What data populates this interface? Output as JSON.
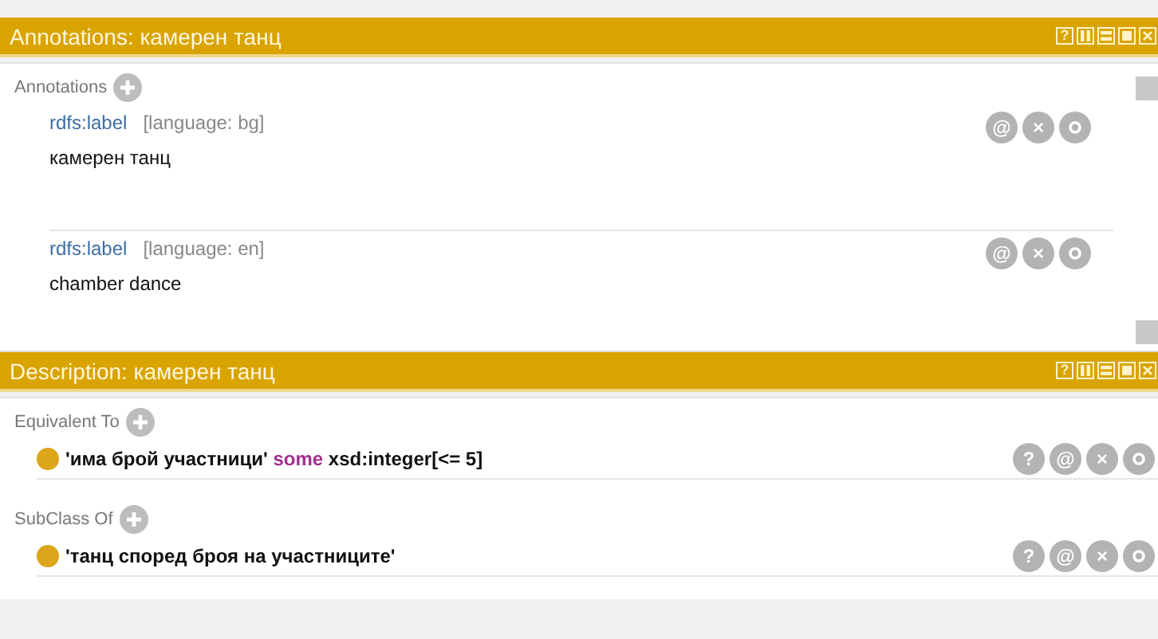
{
  "panels": [
    {
      "title": "Annotations: камерен танц",
      "header_buttons": [
        {
          "kind": "help",
          "glyph": "?"
        },
        {
          "kind": "split-v"
        },
        {
          "kind": "split-h"
        },
        {
          "kind": "maximize"
        },
        {
          "kind": "close"
        }
      ],
      "scrollbar": true,
      "sections": [
        {
          "label": "Annotations",
          "items": [
            {
              "kind": "annotation",
              "property": "rdfs:label",
              "language": "[language: bg]",
              "value": "камерен танц",
              "actions": [
                {
                  "kind": "annotate",
                  "glyph": "@"
                },
                {
                  "kind": "delete",
                  "glyph": "×"
                },
                {
                  "kind": "edit"
                }
              ]
            },
            {
              "kind": "annotation",
              "property": "rdfs:label",
              "language": "[language: en]",
              "value": "chamber dance",
              "actions": [
                {
                  "kind": "annotate",
                  "glyph": "@"
                },
                {
                  "kind": "delete",
                  "glyph": "×"
                },
                {
                  "kind": "edit"
                }
              ]
            }
          ]
        }
      ]
    },
    {
      "title": "Description: камерен танц",
      "header_buttons": [
        {
          "kind": "help",
          "glyph": "?"
        },
        {
          "kind": "split-v"
        },
        {
          "kind": "split-h"
        },
        {
          "kind": "maximize"
        },
        {
          "kind": "close"
        }
      ],
      "scrollbar": false,
      "sections": [
        {
          "label": "Equivalent To",
          "items": [
            {
              "kind": "expression",
              "parts": [
                {
                  "kind": "plain",
                  "text": "'има брой участници'"
                },
                {
                  "kind": "keyword",
                  "text": "some"
                },
                {
                  "kind": "plain",
                  "text": "xsd:integer[<= 5]"
                }
              ],
              "actions": [
                {
                  "kind": "explain",
                  "glyph": "?"
                },
                {
                  "kind": "annotate",
                  "glyph": "@"
                },
                {
                  "kind": "delete",
                  "glyph": "×"
                },
                {
                  "kind": "edit"
                }
              ]
            }
          ]
        },
        {
          "label": "SubClass Of",
          "items": [
            {
              "kind": "expression",
              "parts": [
                {
                  "kind": "plain",
                  "text": "'танц според броя на участниците'"
                }
              ],
              "actions": [
                {
                  "kind": "explain",
                  "glyph": "?"
                },
                {
                  "kind": "annotate",
                  "glyph": "@"
                },
                {
                  "kind": "delete",
                  "glyph": "×"
                },
                {
                  "kind": "edit"
                }
              ]
            }
          ]
        }
      ]
    }
  ]
}
